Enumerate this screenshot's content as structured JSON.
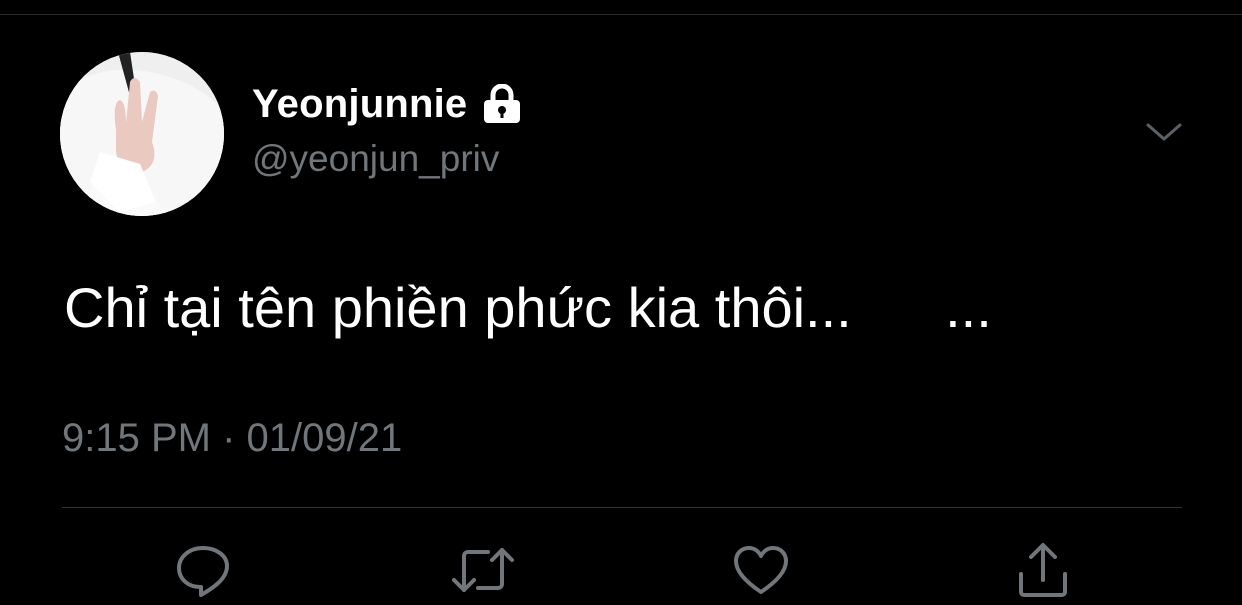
{
  "tweet": {
    "display_name": "Yeonjunnie",
    "handle": "@yeonjun_priv",
    "text": "Chỉ tại tên phiền phức kia thôi...      ...",
    "timestamp": "9:15 PM · 01/09/21"
  },
  "icons": {
    "lock": "lock-icon",
    "menu": "chevron-down-icon",
    "reply": "reply-icon",
    "retweet": "retweet-icon",
    "like": "heart-icon",
    "share": "share-icon"
  },
  "colors": {
    "background": "#000000",
    "primary_text": "#ffffff",
    "secondary_text": "#71767b",
    "divider": "#2f3336"
  }
}
